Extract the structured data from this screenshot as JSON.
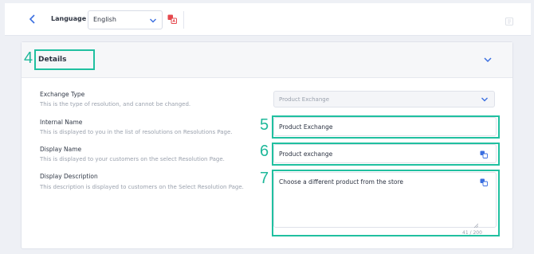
{
  "topbar": {
    "back_icon": "chevron-left-icon",
    "language_label": "Language",
    "language_value": "English",
    "translate_icon": "translate-icon"
  },
  "section": {
    "number": "4",
    "title": "Details",
    "collapse_icon": "chevron-down-icon"
  },
  "fields": {
    "exchange_type": {
      "label": "Exchange Type",
      "description": "This is the type of resolution, and cannot be changed.",
      "value": "Product Exchange"
    },
    "internal_name": {
      "number": "5",
      "label": "Internal Name",
      "description": "This is displayed to you in the list of resolutions on Resolutions Page.",
      "value": "Product Exchange"
    },
    "display_name": {
      "number": "6",
      "label": "Display Name",
      "description": "This is displayed to your customers on the select Resolution Page.",
      "value": "Product exchange"
    },
    "display_description": {
      "number": "7",
      "label": "Display Description",
      "description": "This description is displayed to customers on the Select Resolution Page.",
      "value": "Choose a different product from the store",
      "counter": "41 / 200"
    }
  },
  "colors": {
    "accent": "#3b6fe0",
    "highlight": "#20c0a0",
    "translate_red": "#e5484d"
  }
}
